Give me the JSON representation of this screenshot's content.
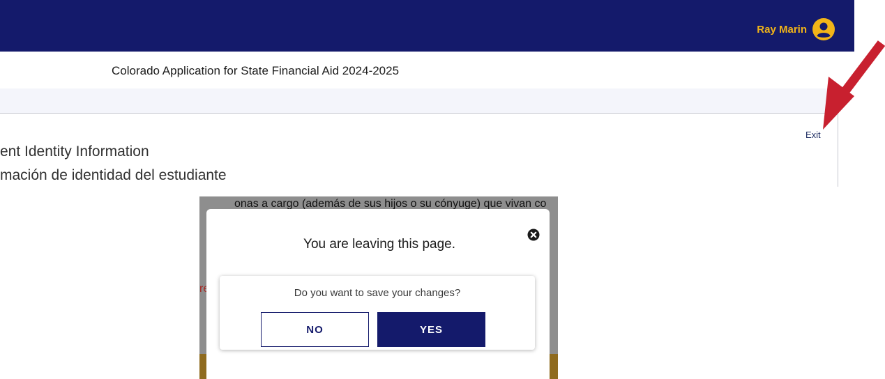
{
  "header": {
    "user_name": "Ray Marin",
    "app_title": "Colorado Application for State Financial Aid 2024-2025"
  },
  "page": {
    "exit_label": "Exit",
    "heading_en": "ent Identity Information",
    "heading_es": "mación de identidad del estudiante",
    "background_text": "onas a cargo (además de sus hijos o su cónyuge) que vivan co",
    "background_red_fragment": "re"
  },
  "modal": {
    "title": "You are leaving this page.",
    "question": "Do you want to save your changes?",
    "no_label": "NO",
    "yes_label": "YES"
  },
  "colors": {
    "brand_navy": "#141a6b",
    "accent_gold": "#f2b418",
    "annotation_red": "#c8202f"
  },
  "icons": {
    "user": "user-avatar-icon",
    "close": "close-circle-icon",
    "annotation": "red-arrow-icon"
  }
}
